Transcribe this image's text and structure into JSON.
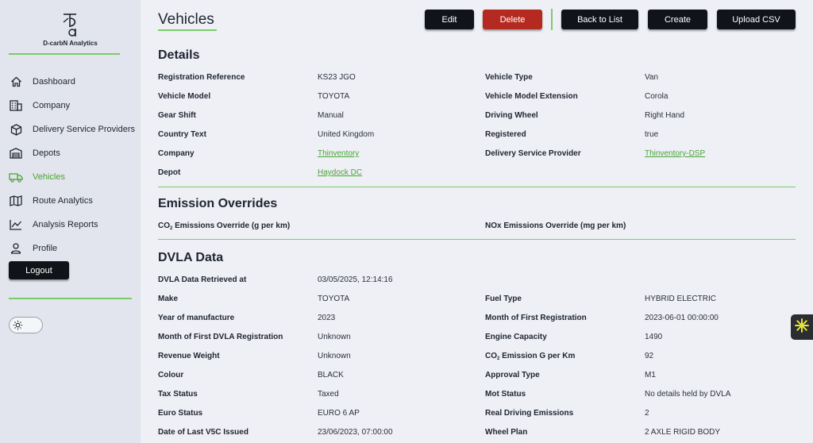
{
  "sidebar": {
    "logo_text": "D-carbN Analytics",
    "items": [
      {
        "label": "Dashboard",
        "icon": "home-icon"
      },
      {
        "label": "Company",
        "icon": "building-icon"
      },
      {
        "label": "Delivery Service Providers",
        "icon": "box-icon"
      },
      {
        "label": "Depots",
        "icon": "warehouse-icon"
      },
      {
        "label": "Vehicles",
        "icon": "truck-icon"
      },
      {
        "label": "Route Analytics",
        "icon": "map-icon"
      },
      {
        "label": "Analysis Reports",
        "icon": "chart-icon"
      },
      {
        "label": "Profile",
        "icon": "user-icon"
      }
    ],
    "active_index": 4,
    "logout_label": "Logout"
  },
  "header": {
    "title": "Vehicles",
    "buttons": {
      "edit": "Edit",
      "delete": "Delete",
      "back": "Back to List",
      "create": "Create",
      "upload": "Upload CSV"
    }
  },
  "details": {
    "title": "Details",
    "rows": [
      {
        "l1": "Registration Reference",
        "v1": "KS23 JGO",
        "l2": "Vehicle Type",
        "v2": "Van"
      },
      {
        "l1": "Vehicle Model",
        "v1": "TOYOTA",
        "l2": "Vehicle Model Extension",
        "v2": "Corola"
      },
      {
        "l1": "Gear Shift",
        "v1": "Manual",
        "l2": "Driving Wheel",
        "v2": "Right Hand"
      },
      {
        "l1": "Country Text",
        "v1": "United Kingdom",
        "l2": "Registered",
        "v2": "true"
      },
      {
        "l1": "Company",
        "v1": "Thinventory",
        "l2": "Delivery Service Provider",
        "v2": "Thinventory-DSP"
      },
      {
        "l1": "Depot",
        "v1": "Haydock DC"
      }
    ]
  },
  "emissions": {
    "title": "Emission Overrides",
    "co2_prefix": "CO",
    "co2_sub": "2",
    "co2_suffix": " Emissions Override (g per km)",
    "nox_label": "NOx Emissions Override (mg per km)"
  },
  "dvla": {
    "title": "DVLA Data",
    "retrieved_label": "DVLA Data Retrieved at",
    "retrieved_value": "03/05/2025, 12:14:16",
    "co2_prefix": "CO",
    "co2_sub": "2",
    "co2_suffix": " Emission G per Km",
    "rows": [
      {
        "l1": "Make",
        "v1": "TOYOTA",
        "l2": "Fuel Type",
        "v2": "HYBRID ELECTRIC"
      },
      {
        "l1": "Year of manufacture",
        "v1": "2023",
        "l2": "Month of First Registration",
        "v2": "2023-06-01 00:00:00"
      },
      {
        "l1": "Month of First DVLA Registration",
        "v1": "Unknown",
        "l2": "Engine Capacity",
        "v2": "1490"
      },
      {
        "l1": "Revenue Weight",
        "v1": "Unknown",
        "v2": "92"
      },
      {
        "l1": "Colour",
        "v1": "BLACK",
        "l2": "Approval Type",
        "v2": "M1"
      },
      {
        "l1": "Tax Status",
        "v1": "Taxed",
        "l2": "Mot Status",
        "v2": "No details held by DVLA"
      },
      {
        "l1": "Euro Status",
        "v1": "EURO 6 AP",
        "l2": "Real Driving Emissions",
        "v2": "2"
      },
      {
        "l1": "Date of Last V5C Issued",
        "v1": "23/06/2023, 07:00:00",
        "l2": "Wheel Plan",
        "v2": "2 AXLE RIGID BODY"
      }
    ]
  },
  "colors": {
    "accent": "#7ccb6a",
    "active": "#4aa336",
    "delete": "#b52a20",
    "button": "#11131a"
  }
}
